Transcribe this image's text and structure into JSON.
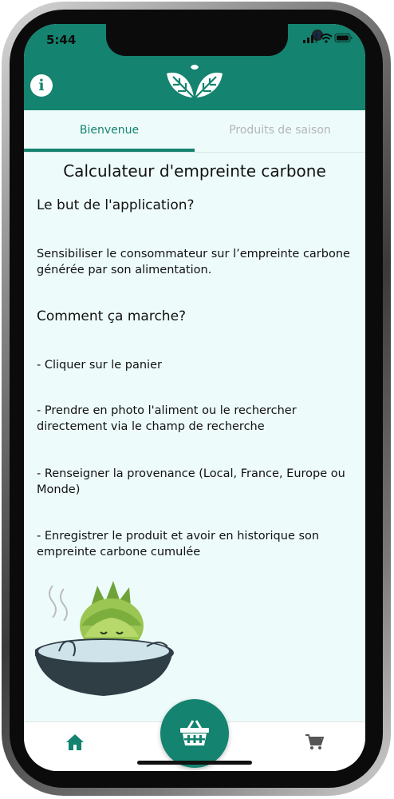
{
  "status_bar": {
    "time": "5:44"
  },
  "colors": {
    "primary": "#14836f",
    "background": "#eefbfb",
    "inactive_tab": "#b5b5b5"
  },
  "header": {
    "info_icon": "info-icon",
    "logo_icon": "leaves-logo-icon"
  },
  "tabs": [
    {
      "label": "Bienvenue",
      "active": true
    },
    {
      "label": "Produits de saison",
      "active": false
    }
  ],
  "content": {
    "title": "Calculateur d'empreinte carbone",
    "section1_heading": "Le but de l'application?",
    "section1_text": "Sensibiliser le consommateur sur l’empreinte carbone générée par son alimentation.",
    "section2_heading": "Comment ça marche?",
    "steps": [
      "- Cliquer sur le panier",
      "- Prendre en photo l'aliment ou le rechercher directement via le champ de recherche",
      "- Renseigner la provenance (Local, France, Europe ou Monde)",
      "- Enregistrer le produit et avoir en historique son empreinte carbone cumulée"
    ]
  },
  "bottom_nav": {
    "home_icon": "home-icon",
    "basket_icon": "basket-icon",
    "cart_icon": "cart-icon"
  }
}
